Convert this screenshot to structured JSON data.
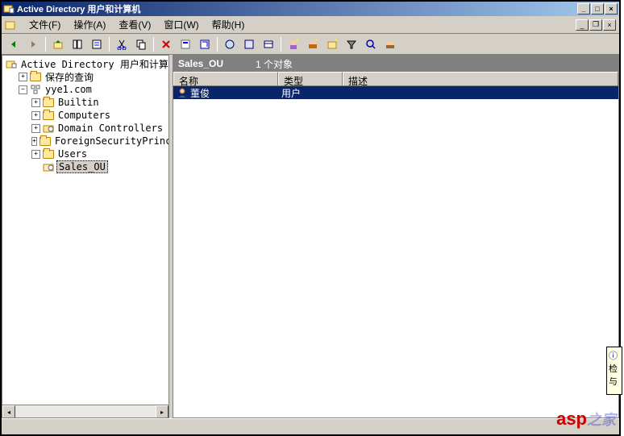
{
  "window": {
    "title": "Active Directory 用户和计算机"
  },
  "menubar": {
    "file": "文件(F)",
    "action": "操作(A)",
    "view": "查看(V)",
    "window": "窗口(W)",
    "help": "帮助(H)"
  },
  "tree": {
    "root": "Active Directory 用户和计算机",
    "saved_queries": "保存的查询",
    "domain": "yye1.com",
    "nodes": [
      "Builtin",
      "Computers",
      "Domain Controllers",
      "ForeignSecurityPrincipa",
      "Users",
      "Sales_OU"
    ]
  },
  "list": {
    "header_title": "Sales_OU",
    "header_count": "1 个对象",
    "columns": {
      "name": "名称",
      "type": "类型",
      "desc": "描述"
    },
    "rows": [
      {
        "name": "董俊",
        "type": "用户",
        "desc": ""
      }
    ]
  },
  "watermark": {
    "asp": "asp",
    "rest": "之家"
  },
  "sideinfo": {
    "l1": "检",
    "l2": "与"
  }
}
